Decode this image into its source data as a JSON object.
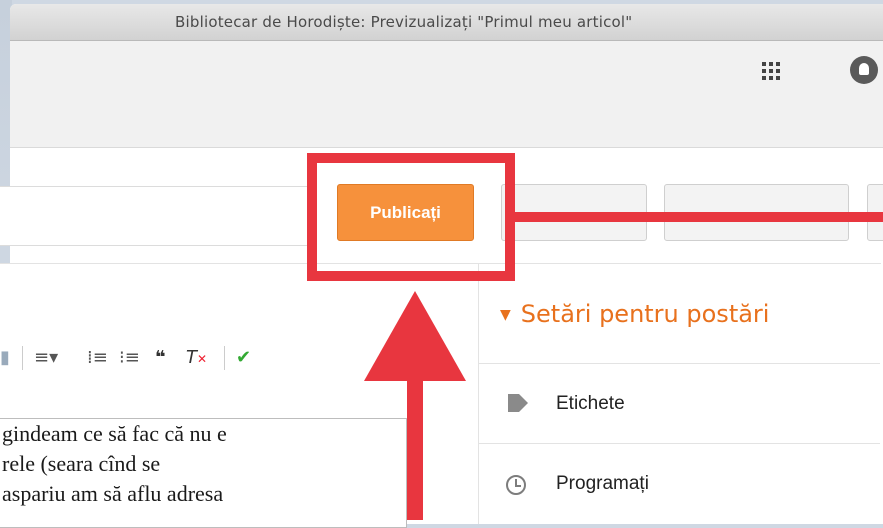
{
  "window": {
    "title": "Bibliotecar de Horodiște: Previzualizați \"Primul meu articol\""
  },
  "toolbar": {
    "publish_label": "Publicați"
  },
  "format_bar": {
    "items": [
      "align-icon",
      "numbered-list-icon",
      "bullet-list-icon",
      "quote-icon",
      "clear-format-icon",
      "spellcheck-icon"
    ]
  },
  "editor": {
    "lines": [
      "gindeam ce să fac că nu e",
      "rele (seara cînd se",
      "aspariu am să aflu adresa"
    ]
  },
  "side_panel": {
    "heading": "Setări pentru postări",
    "rows": [
      {
        "label": "Etichete",
        "icon": "tag-icon"
      },
      {
        "label": "Programați",
        "icon": "clock-icon"
      }
    ]
  },
  "colors": {
    "accent": "#f6913c",
    "annotation": "#e8363f",
    "heading": "#e8711d"
  }
}
